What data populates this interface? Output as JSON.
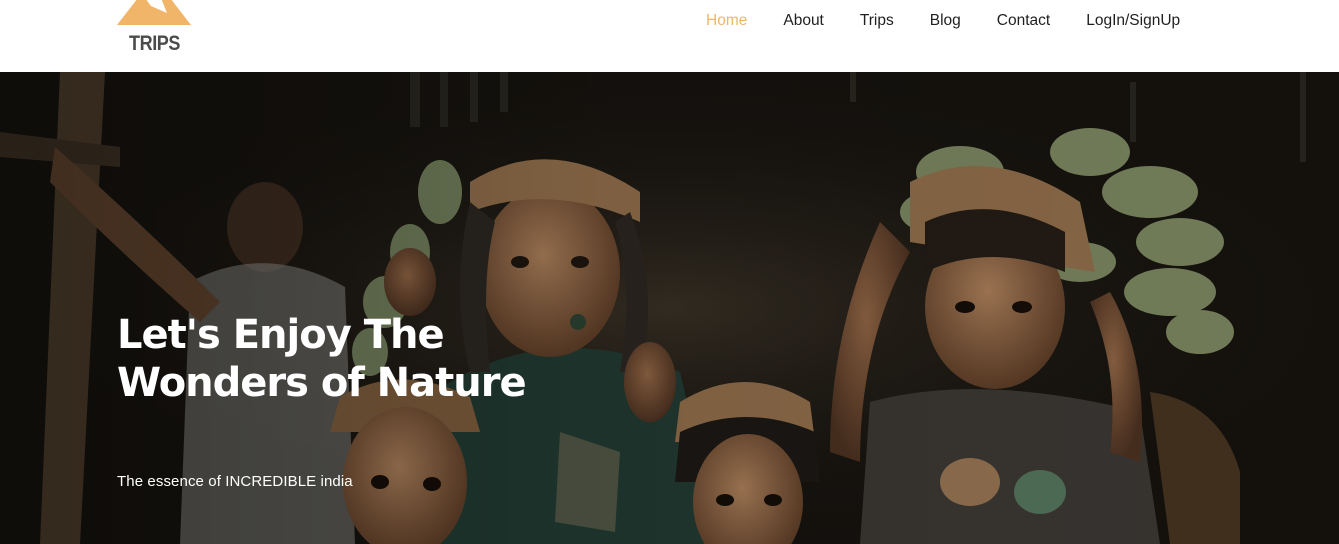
{
  "brand": {
    "name": "TRIPS",
    "accent_color": "#f0b569",
    "text_color": "#4b4b4b"
  },
  "nav": {
    "items": [
      {
        "label": "Home",
        "active": true
      },
      {
        "label": "About",
        "active": false
      },
      {
        "label": "Trips",
        "active": false
      },
      {
        "label": "Blog",
        "active": false
      },
      {
        "label": "Contact",
        "active": false
      },
      {
        "label": "LogIn/SignUp",
        "active": false
      }
    ]
  },
  "hero": {
    "title": "Let's Enjoy The Wonders of Nature",
    "subtitle": "The essence of INCREDIBLE india",
    "image_subject": "villagers-carrying-bananas-photo"
  }
}
